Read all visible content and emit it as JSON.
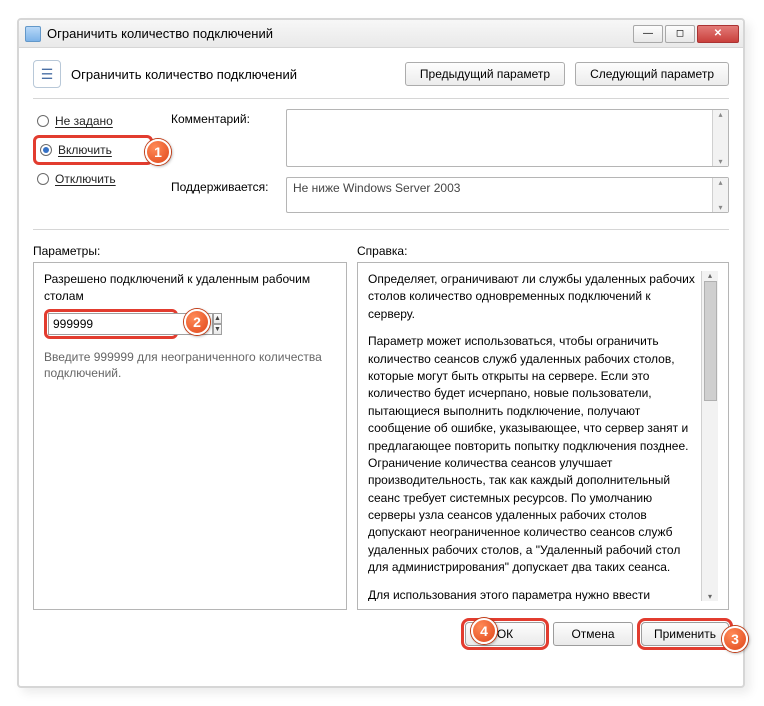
{
  "window": {
    "title": "Ограничить количество подключений"
  },
  "header": {
    "policy_title": "Ограничить количество подключений",
    "prev_btn": "Предыдущий параметр",
    "next_btn": "Следующий параметр"
  },
  "radios": {
    "not_configured": "Не задано",
    "enabled": "Включить",
    "disabled": "Отключить",
    "selected": "enabled"
  },
  "kv": {
    "comment_label": "Комментарий:",
    "supported_label": "Поддерживается:",
    "supported_value": "Не ниже Windows Server 2003"
  },
  "sections": {
    "params_label": "Параметры:",
    "help_label": "Справка:"
  },
  "params": {
    "option_label": "Разрешено подключений к удаленным рабочим столам",
    "value": "999999",
    "hint": "Введите 999999 для неограниченного количества подключений."
  },
  "help": {
    "p1": "Определяет, ограничивают ли службы удаленных рабочих столов количество одновременных подключений к серверу.",
    "p2": "Параметр может использоваться, чтобы ограничить количество сеансов служб удаленных рабочих столов, которые могут быть открыты на сервере. Если это количество будет исчерпано, новые пользователи, пытающиеся выполнить подключение, получают сообщение об ошибке, указывающее, что сервер занят и предлагающее повторить попытку подключения позднее. Ограничение количества сеансов улучшает производительность, так как каждый дополнительный сеанс требует системных ресурсов. По умолчанию серверы узла сеансов удаленных рабочих столов допускают неограниченное количество сеансов служб удаленных рабочих столов, а \"Удаленный рабочий стол для администрирования\" допускает два таких сеанса.",
    "p3": "Для использования этого параметра нужно ввести максимальное количество подключений для сервера. Чтобы"
  },
  "buttons": {
    "ok": "ОК",
    "cancel": "Отмена",
    "apply": "Применить"
  },
  "badges": {
    "b1": "1",
    "b2": "2",
    "b3": "3",
    "b4": "4"
  }
}
